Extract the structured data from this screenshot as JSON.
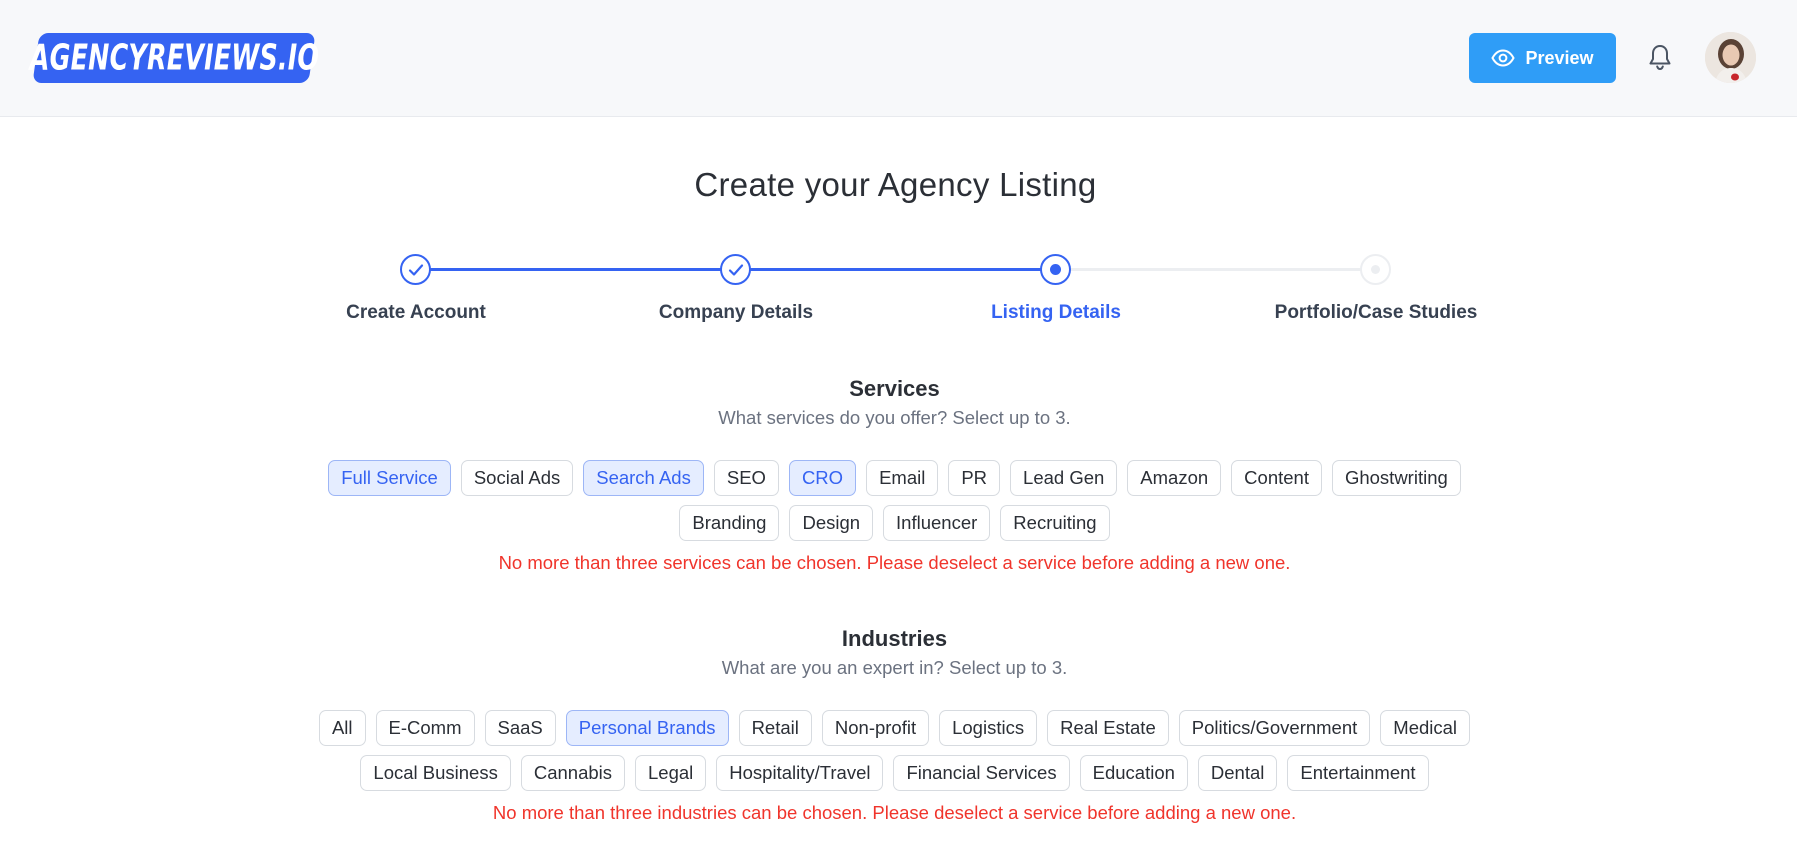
{
  "header": {
    "logo_text": "AGENCYREVIEWS.IO",
    "preview_label": "Preview",
    "bell_icon": "bell-icon",
    "eye_icon": "eye-icon",
    "brand_color": "#3563f2",
    "preview_color": "#2f9df7"
  },
  "page": {
    "title": "Create your Agency Listing"
  },
  "steps": [
    {
      "label": "Create Account",
      "state": "done"
    },
    {
      "label": "Company Details",
      "state": "done"
    },
    {
      "label": "Listing Details",
      "state": "current"
    },
    {
      "label": "Portfolio/Case Studies",
      "state": "todo"
    }
  ],
  "services": {
    "title": "Services",
    "subtitle": "What services do you offer? Select up to 3.",
    "options": [
      {
        "label": "Full Service",
        "selected": true
      },
      {
        "label": "Social Ads",
        "selected": false
      },
      {
        "label": "Search Ads",
        "selected": true
      },
      {
        "label": "SEO",
        "selected": false
      },
      {
        "label": "CRO",
        "selected": true
      },
      {
        "label": "Email",
        "selected": false
      },
      {
        "label": "PR",
        "selected": false
      },
      {
        "label": "Lead Gen",
        "selected": false
      },
      {
        "label": "Amazon",
        "selected": false
      },
      {
        "label": "Content",
        "selected": false
      },
      {
        "label": "Ghostwriting",
        "selected": false
      },
      {
        "label": "Branding",
        "selected": false
      },
      {
        "label": "Design",
        "selected": false
      },
      {
        "label": "Influencer",
        "selected": false
      },
      {
        "label": "Recruiting",
        "selected": false
      }
    ],
    "error": "No more than three services can be chosen. Please deselect a service before adding a new one."
  },
  "industries": {
    "title": "Industries",
    "subtitle": "What are you an expert in? Select up to 3.",
    "options": [
      {
        "label": "All",
        "selected": false
      },
      {
        "label": "E-Comm",
        "selected": false
      },
      {
        "label": "SaaS",
        "selected": false
      },
      {
        "label": "Personal Brands",
        "selected": true
      },
      {
        "label": "Retail",
        "selected": false
      },
      {
        "label": "Non-profit",
        "selected": false
      },
      {
        "label": "Logistics",
        "selected": false
      },
      {
        "label": "Real Estate",
        "selected": false
      },
      {
        "label": "Politics/Government",
        "selected": false
      },
      {
        "label": "Medical",
        "selected": false
      },
      {
        "label": "Local Business",
        "selected": false
      },
      {
        "label": "Cannabis",
        "selected": false
      },
      {
        "label": "Legal",
        "selected": false
      },
      {
        "label": "Hospitality/Travel",
        "selected": false
      },
      {
        "label": "Financial Services",
        "selected": false
      },
      {
        "label": "Education",
        "selected": false
      },
      {
        "label": "Dental",
        "selected": false
      },
      {
        "label": "Entertainment",
        "selected": false
      }
    ],
    "error": "No more than three industries can be chosen. Please deselect a service before adding a new one."
  },
  "colors": {
    "error": "#f0342b",
    "selected_bg": "#e5edff",
    "selected_text": "#3563f2"
  }
}
